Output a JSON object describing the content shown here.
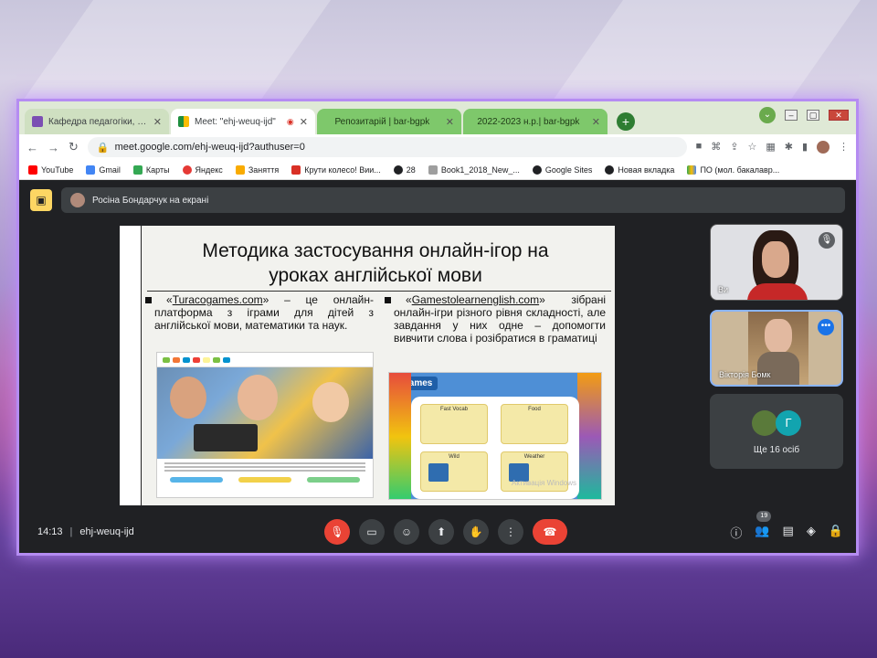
{
  "browser": {
    "tabs": [
      {
        "title": "Кафедра педагогіки, психології",
        "state": "inactive",
        "fav_color": "#7b4fb3"
      },
      {
        "title": "Meet: \"ehj-weuq-ijd\"",
        "state": "active",
        "fav_color": "#1e8e3e"
      },
      {
        "title": "Репозитарій | bar-bgpk",
        "state": "green",
        "fav_color": "#3d7a2c"
      },
      {
        "title": "2022-2023 н.р.| bar-bgpk",
        "state": "green",
        "fav_color": "#3d7a2c"
      }
    ],
    "new_tab_label": "+",
    "url": "meet.google.com/ehj-weuq-ijd?authuser=0",
    "bookmarks": [
      "YouTube",
      "Gmail",
      "Карты",
      "Яндекс",
      "Заняття",
      "Крути колесо! Вии...",
      "28",
      "Book1_2018_New_...",
      "Google Sites",
      "Новая вкладка",
      "ПО (мол. бакалавр..."
    ]
  },
  "meet": {
    "presenter_label": "Росіна Бондарчук на екрані",
    "meeting_time": "14:13",
    "meeting_code": "ehj-weuq-ijd",
    "participants_count": "19",
    "tiles": [
      {
        "name": "Ви"
      },
      {
        "name": "Вікторія Бомк"
      },
      {
        "avatar_letter": "Г",
        "others_label": "Ще 16 осіб"
      }
    ]
  },
  "slide": {
    "title_line1": "Методика застосування онлайн-ігор на",
    "title_line2": "уроках англійської мови",
    "col1_link": "Turacogames.com",
    "col1_text": " – це онлайн-платформа з іграми для дітей з англійської мови, математики та наук.",
    "col2_link": "Gamestolearnenglish.com",
    "col2_text": " зібрані онлайн-ігри різного рівня складності, але завдання у них одне – допомогти вивчити слова і розібратися в граматиці",
    "shot2_logo": "Games",
    "shot2_cards": [
      "Fast Vocab",
      "Food",
      "Wild",
      "Weather"
    ],
    "shot2_watermark": "Активація Windows"
  },
  "colors": {
    "accent_border": "#b58cf2",
    "meet_bg": "#202124",
    "end_call": "#ea4335",
    "presenting_badge": "#fdd663"
  }
}
